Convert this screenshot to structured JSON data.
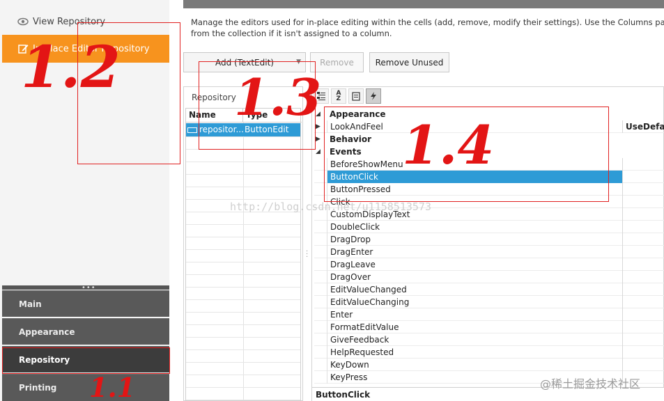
{
  "sidebar": {
    "top_items": [
      {
        "label": "View Repository",
        "icon": "eye-icon"
      },
      {
        "label": "In-place Editor Repository",
        "icon": "edit-icon"
      }
    ],
    "sections": [
      "Main",
      "Appearance",
      "Repository",
      "Printing"
    ],
    "active_section": "Repository",
    "active_item": "In-place Editor Repository"
  },
  "main": {
    "description_line1": "Manage the editors used for in-place editing within the cells (add, remove, modify their settings). Use the Columns page to ass",
    "description_line2": "from the collection if it isn't assigned to a column.",
    "buttons": {
      "add": "Add (TextEdit)",
      "remove": "Remove",
      "remove_unused": "Remove Unused"
    },
    "repository": {
      "caption": "Repository",
      "columns": [
        "Name",
        "Type"
      ],
      "rows": [
        {
          "name": "repositor...",
          "type": "ButtonEdit"
        }
      ]
    },
    "property_grid": {
      "toolbar": [
        "categorized-icon",
        "alphabetical-icon",
        "properties-icon",
        "events-icon"
      ],
      "rows": [
        {
          "kind": "cat",
          "label": "Appearance",
          "expanded": true
        },
        {
          "kind": "item",
          "label": "LookAndFeel",
          "value": "UseDefau",
          "expandable": true
        },
        {
          "kind": "cat",
          "label": "Behavior",
          "expanded": false
        },
        {
          "kind": "cat",
          "label": "Events",
          "expanded": true
        },
        {
          "kind": "item",
          "label": "BeforeShowMenu"
        },
        {
          "kind": "item",
          "label": "ButtonClick",
          "selected": true
        },
        {
          "kind": "item",
          "label": "ButtonPressed"
        },
        {
          "kind": "item",
          "label": "Click"
        },
        {
          "kind": "item",
          "label": "CustomDisplayText"
        },
        {
          "kind": "item",
          "label": "DoubleClick"
        },
        {
          "kind": "item",
          "label": "DragDrop"
        },
        {
          "kind": "item",
          "label": "DragEnter"
        },
        {
          "kind": "item",
          "label": "DragLeave"
        },
        {
          "kind": "item",
          "label": "DragOver"
        },
        {
          "kind": "item",
          "label": "EditValueChanged"
        },
        {
          "kind": "item",
          "label": "EditValueChanging"
        },
        {
          "kind": "item",
          "label": "Enter"
        },
        {
          "kind": "item",
          "label": "FormatEditValue"
        },
        {
          "kind": "item",
          "label": "GiveFeedback"
        },
        {
          "kind": "item",
          "label": "HelpRequested"
        },
        {
          "kind": "item",
          "label": "KeyDown"
        },
        {
          "kind": "item",
          "label": "KeyPress"
        }
      ],
      "footer": "ButtonClick"
    }
  },
  "annotations": {
    "mark_12": "1.2",
    "mark_13": "1.3",
    "mark_14": "1.4",
    "mark_11": "1.1"
  },
  "watermark": "http://blog.csdn.net/u1158513573",
  "site_mark": "@稀土掘金技术社区",
  "colors": {
    "accent_orange": "#f7931e",
    "selection_blue": "#2e9bd6",
    "annotation_red": "#e31515",
    "nav_dark": "#595959"
  }
}
